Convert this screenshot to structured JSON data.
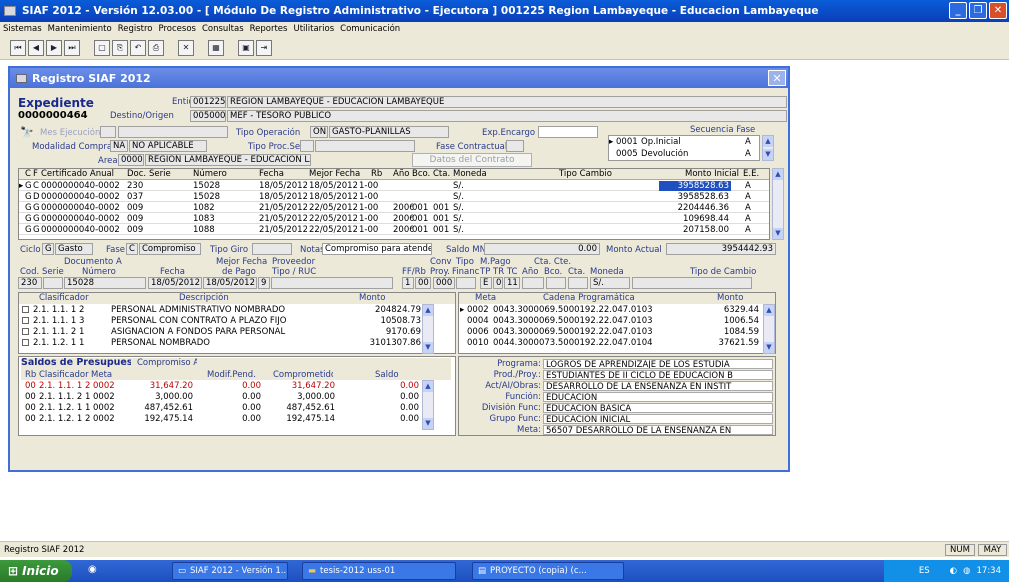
{
  "window": {
    "title": "SIAF 2012 - Versión 12.03.00 - [ Módulo De Registro Administrativo - Ejecutora ] 001225 Region Lambayeque - Educacion Lambayeque"
  },
  "menu": [
    "Sistemas",
    "Mantenimiento",
    "Registro",
    "Procesos",
    "Consultas",
    "Reportes",
    "Utilitarios",
    "Comunicación"
  ],
  "child": {
    "title": "Registro SIAF 2012"
  },
  "exp": {
    "label": "Expediente",
    "number": "0000000464",
    "entidad_label": "Entidad",
    "entidad_code": "001225",
    "entidad_name": "REGION LAMBAYEQUE - EDUCACION LAMBAYEQUE",
    "destino_label": "Destino/Origen",
    "destino_code": "005000",
    "destino_name": "MEF - TESORO PÚBLICO"
  },
  "op": {
    "mes_label": "Mes Ejecución",
    "tipo_op_label": "Tipo Operación",
    "tipo_op_code": "ON",
    "tipo_op_name": "GASTO-PLANILLAS",
    "encargo_label": "Exp.Encargo",
    "secuencia_label": "Secuencia Fase",
    "modalidad_label": "Modalidad Compra",
    "modalidad_code": "NA",
    "modalidad_name": "NO APLICABLE",
    "tipo_proc_label": "Tipo Proc.Sel.",
    "fase_contr_label": "Fase Contractual",
    "area_label": "Area",
    "area_code": "0000",
    "area_name": "REGION LAMBAYEQUE - EDUCACION LAMBA",
    "datos_contrato": "Datos del Contrato"
  },
  "secuencia": [
    {
      "code": "0001",
      "name": "Op.Inicial",
      "flag": "A"
    },
    {
      "code": "0005",
      "name": "Devolución",
      "flag": "A"
    }
  ],
  "cert_headers": {
    "c": "C",
    "f": "F",
    "cert": "Certificado Anual",
    "doc": "Doc.",
    "serie": "Serie",
    "numero": "Número",
    "fecha": "Fecha",
    "mejor": "Mejor Fecha",
    "rb": "Rb",
    "anio": "Año",
    "bco": "Bco.",
    "cta": "Cta.",
    "moneda": "Moneda",
    "tc": "Tipo Cambio",
    "monto": "Monto Inicial",
    "ee": "E.E."
  },
  "cert_rows": [
    {
      "c": "G",
      "f": "C",
      "cert": "0000000040-0002",
      "doc": "230",
      "numero": "15028",
      "fecha": "18/05/2012",
      "mejor": "18/05/2012",
      "rb": "1-00",
      "anio": "",
      "bco": "",
      "cta": "",
      "moneda": "S/.",
      "monto": "3958528.63",
      "ee": "A"
    },
    {
      "c": "G",
      "f": "D",
      "cert": "0000000040-0002",
      "doc": "037",
      "numero": "15028",
      "fecha": "18/05/2012",
      "mejor": "18/05/2012",
      "rb": "1-00",
      "anio": "",
      "bco": "",
      "cta": "",
      "moneda": "S/.",
      "monto": "3958528.63",
      "ee": "A"
    },
    {
      "c": "G",
      "f": "G",
      "cert": "0000000040-0002",
      "doc": "009",
      "numero": "1082",
      "fecha": "21/05/2012",
      "mejor": "22/05/2012",
      "rb": "1-00",
      "anio": "2006",
      "bco": "001",
      "cta": "001",
      "moneda": "S/.",
      "monto": "2204446.36",
      "ee": "A"
    },
    {
      "c": "G",
      "f": "G",
      "cert": "0000000040-0002",
      "doc": "009",
      "numero": "1083",
      "fecha": "21/05/2012",
      "mejor": "22/05/2012",
      "rb": "1-00",
      "anio": "2006",
      "bco": "001",
      "cta": "001",
      "moneda": "S/.",
      "monto": "109698.44",
      "ee": "A"
    },
    {
      "c": "G",
      "f": "G",
      "cert": "0000000040-0002",
      "doc": "009",
      "numero": "1088",
      "fecha": "21/05/2012",
      "mejor": "22/05/2012",
      "rb": "1-00",
      "anio": "2006",
      "bco": "001",
      "cta": "001",
      "moneda": "S/.",
      "monto": "207158.00",
      "ee": "A"
    }
  ],
  "ciclo": {
    "ciclo_label": "Ciclo",
    "ciclo_code": "G",
    "ciclo_name": "Gasto",
    "fase_label": "Fase",
    "fase_code": "C",
    "fase_name": "Compromiso",
    "giro_label": "Tipo Giro",
    "notas_label": "Notas",
    "notas": "Compromiso para atender",
    "saldo_label": "Saldo MN",
    "saldo": "0.00",
    "monto_actual_label": "Monto Actual",
    "monto_actual": "3954442.93"
  },
  "doc": {
    "documento_a": "Documento A",
    "mejor_fecha": "Mejor Fecha",
    "proveedor": "Proveedor",
    "conv": "Conv",
    "tipo": "Tipo",
    "mpago": "M.Pago",
    "ctacte": "Cta. Cte.",
    "cod": "Cod.",
    "serie": "Serie",
    "numero": "Número",
    "fecha": "Fecha",
    "de_pago": "de Pago",
    "tipo_ruc": "Tipo / RUC",
    "ffrb": "FF/Rb",
    "proy": "Proy.",
    "financ": "Financ",
    "tptrtc": "TP TR TC",
    "anio": "Año",
    "bco": "Bco.",
    "cta": "Cta.",
    "moneda": "Moneda",
    "tipo_cambio": "Tipo de Cambio",
    "v_cod": "230",
    "v_numero": "15028",
    "v_fecha": "18/05/2012",
    "v_mejor": "18/05/2012",
    "v_tipo": "9",
    "v_ff": "1",
    "v_rb": "00",
    "v_proy": "000",
    "v_tp": "E",
    "v_tr": "0",
    "v_tc": "11",
    "v_moneda": "S/."
  },
  "clasif": {
    "h_clas": "Clasificador",
    "h_desc": "Descripción",
    "h_monto": "Monto",
    "rows": [
      {
        "clas": "2.1. 1.1. 1 2",
        "desc": "PERSONAL ADMINISTRATIVO NOMBRADO",
        "monto": "204824.79"
      },
      {
        "clas": "2.1. 1.1. 1 3",
        "desc": "PERSONAL CON CONTRATO A PLAZO FIJO",
        "monto": "10508.73"
      },
      {
        "clas": "2.1. 1.1. 2 1",
        "desc": "ASIGNACION A FONDOS PARA PERSONAL",
        "monto": "9170.69"
      },
      {
        "clas": "2.1. 1.2. 1 1",
        "desc": "PERSONAL NOMBRADO",
        "monto": "3101307.86"
      }
    ]
  },
  "meta": {
    "h_meta": "Meta",
    "h_cadena": "Cadena Programática",
    "h_monto": "Monto",
    "rows": [
      {
        "meta": "0002",
        "cadena": "0043.3000069.5000192.22.047.0103",
        "monto": "6329.44"
      },
      {
        "meta": "0004",
        "cadena": "0043.3000069.5000192.22.047.0103",
        "monto": "1006.54"
      },
      {
        "meta": "0006",
        "cadena": "0043.3000069.5000192.22.047.0103",
        "monto": "1084.59"
      },
      {
        "meta": "0010",
        "cadena": "0044.3000073.5000192.22.047.0104",
        "monto": "37621.59"
      }
    ]
  },
  "saldos": {
    "title": "Saldos de Presupuesto",
    "h_rb": "Rb",
    "h_clas": "Clasificador",
    "h_meta": "Meta",
    "h_comp": "Compromiso Anual",
    "h_modif": "Modif.Pend.",
    "h_compr": "Comprometido",
    "h_saldo": "Saldo",
    "rows": [
      {
        "rb": "00",
        "clas": "2.1. 1.1. 1 2",
        "meta": "0002",
        "comp": "31,647.20",
        "modif": "0.00",
        "compr": "31,647.20",
        "saldo": "0.00"
      },
      {
        "rb": "00",
        "clas": "2.1. 1.1. 2 1",
        "meta": "0002",
        "comp": "3,000.00",
        "modif": "0.00",
        "compr": "3,000.00",
        "saldo": "0.00"
      },
      {
        "rb": "00",
        "clas": "2.1. 1.2. 1 1",
        "meta": "0002",
        "comp": "487,452.61",
        "modif": "0.00",
        "compr": "487,452.61",
        "saldo": "0.00"
      },
      {
        "rb": "00",
        "clas": "2.1. 1.2. 1 2",
        "meta": "0002",
        "comp": "192,475.14",
        "modif": "0.00",
        "compr": "192,475.14",
        "saldo": "0.00"
      }
    ]
  },
  "prog": [
    {
      "label": "Programa:",
      "value": "LOGROS DE APRENDIZAJE DE LOS ESTUDIA"
    },
    {
      "label": "Prod./Proy.:",
      "value": "ESTUDIANTES DE II CICLO DE EDUCACION B"
    },
    {
      "label": "Act/AI/Obras:",
      "value": "DESARROLLO DE LA ENSEÑANZA EN INSTIT"
    },
    {
      "label": "Función:",
      "value": "EDUCACION"
    },
    {
      "label": "División Func:",
      "value": "EDUCACION BASICA"
    },
    {
      "label": "Grupo Func:",
      "value": "EDUCACION INICIAL"
    },
    {
      "label": "Meta:",
      "value": "56507   DESARROLLO DE LA ENSEÑANZA EN"
    }
  ],
  "status": {
    "left": "Registro SIAF 2012",
    "num": "NUM",
    "may": "MAY"
  },
  "taskbar": {
    "start": "Inicio",
    "t1": "SIAF 2012 - Versión 1...",
    "t2": "tesis-2012 uss-01",
    "t3": "PROYECTO (copia) (c...",
    "lang": "ES",
    "time": "17:34"
  }
}
